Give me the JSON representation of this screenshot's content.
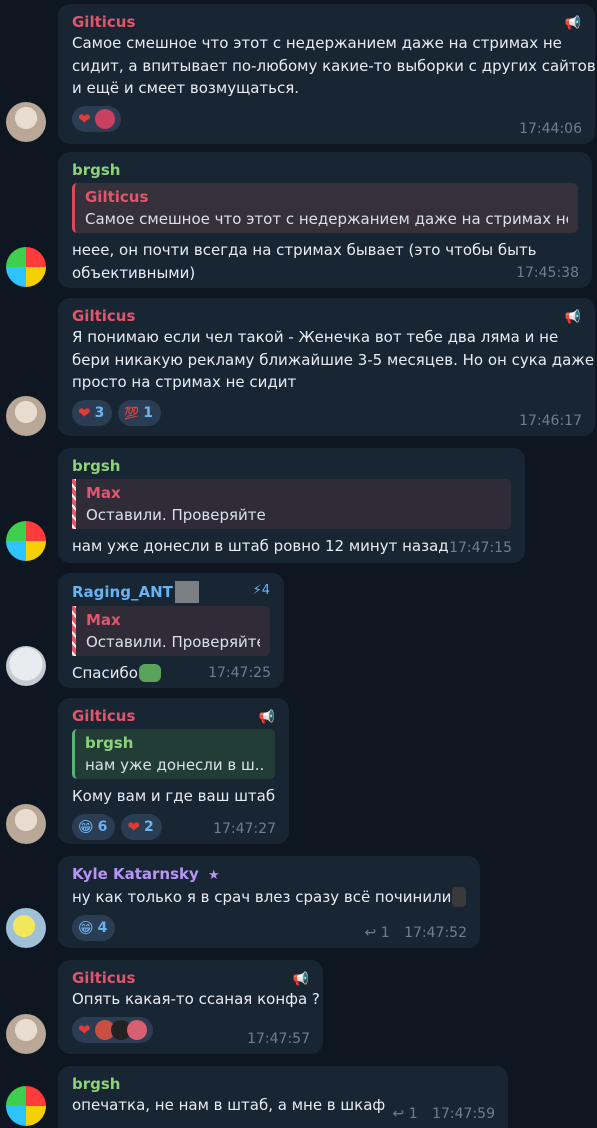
{
  "messages": [
    {
      "author": "Gilticus",
      "text_lines": [
        "Самое смешное что этот с недержанием даже на стримах не",
        "сидит, а впитывает по-любому какие-то выборки с других сайтов",
        "и ещё и смеет возмущаться."
      ],
      "time": "17:44:06",
      "reactions": [
        "❤️"
      ]
    },
    {
      "author": "brgsh",
      "reply_author": "Gilticus",
      "reply_text": "Самое смешное что этот с недержанием даже на стримах не...",
      "text_lines": [
        "неее, он почти всегда на стримах бывает (это чтобы быть",
        "объективными)"
      ],
      "time": "17:45:38"
    },
    {
      "author": "Gilticus",
      "text_lines": [
        "Я понимаю если чел такой - Женечка вот тебе два ляма и не",
        "бери никакую рекламу ближайшие 3-5 месяцев. Но он сука даже",
        "просто на стримах не сидит"
      ],
      "time": "17:46:17",
      "reactions": [
        {
          "emoji": "❤️",
          "count": "3"
        },
        {
          "emoji": "💯",
          "count": "1"
        }
      ]
    },
    {
      "author": "brgsh",
      "reply_author": "Max",
      "reply_text": "Оставили. Проверяйте",
      "text_lines": [
        "нам уже донесли в штаб ровно 12 минут назад"
      ],
      "time": "17:47:15"
    },
    {
      "author": "Raging_ANT",
      "badge": "4",
      "reply_author": "Max",
      "reply_text": "Оставили. Проверяйте",
      "text_lines": [
        "Спасибо"
      ],
      "time": "17:47:25"
    },
    {
      "author": "Gilticus",
      "reply_author": "brgsh",
      "reply_text": "нам уже донесли в ш...",
      "text_lines": [
        "Кому вам и где ваш штаб"
      ],
      "time": "17:47:27",
      "reactions": [
        {
          "emoji": "😁",
          "count": "6"
        },
        {
          "emoji": "❤️",
          "count": "2"
        }
      ]
    },
    {
      "author": "Kyle Katarnsky",
      "text_lines": [
        "ну как только я в срач влез сразу всё починили"
      ],
      "time": "17:47:52",
      "replies": "1",
      "reactions": [
        {
          "emoji": "😁",
          "count": "4"
        }
      ]
    },
    {
      "author": "Gilticus",
      "text_lines": [
        "Опять какая-то ссаная конфа ?"
      ],
      "time": "17:47:57",
      "reactions": [
        "❤️"
      ]
    },
    {
      "author": "brgsh",
      "text_lines": [
        "опечатка, не нам в штаб, а мне в шкаф"
      ],
      "time": "17:47:59",
      "replies": "1"
    }
  ],
  "icons": {
    "pinned": "megaphone-icon",
    "reply": "reply-arrow-icon",
    "premium": "star-icon",
    "boost": "boost-icon"
  },
  "colors": {
    "background": "#0e1621",
    "bubble": "#182533",
    "gilticus": "#e0566a",
    "brgsh": "#8dd178",
    "raging": "#6ab3f3",
    "kyle": "#b794f6"
  }
}
